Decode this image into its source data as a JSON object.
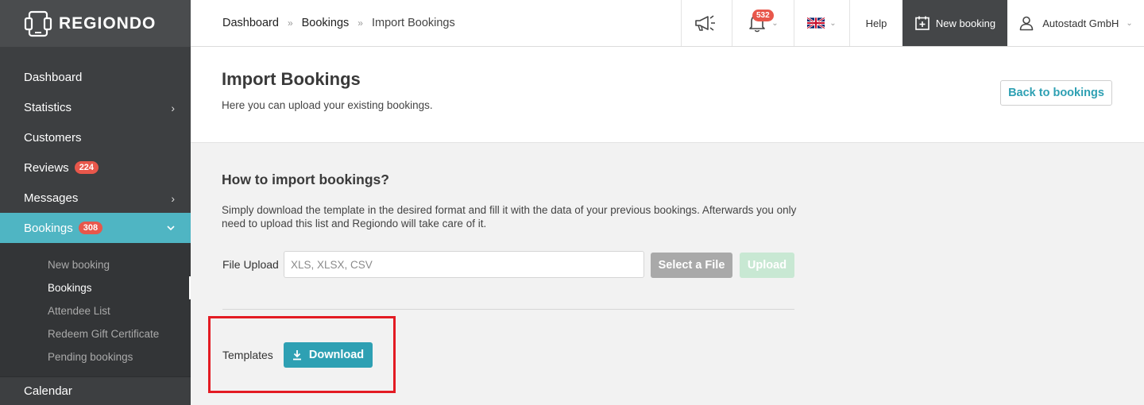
{
  "brand": {
    "name": "REGIONDO"
  },
  "sidebar": {
    "items": [
      {
        "label": "Dashboard"
      },
      {
        "label": "Statistics"
      },
      {
        "label": "Customers"
      },
      {
        "label": "Reviews",
        "badge": "224"
      },
      {
        "label": "Messages"
      },
      {
        "label": "Bookings",
        "badge": "308"
      }
    ],
    "bookings_sub": [
      {
        "label": "New booking"
      },
      {
        "label": "Bookings"
      },
      {
        "label": "Attendee List"
      },
      {
        "label": "Redeem Gift Certificate"
      },
      {
        "label": "Pending bookings"
      }
    ],
    "bottom_item": "Calendar"
  },
  "topbar": {
    "breadcrumb": [
      "Dashboard",
      "Bookings",
      "Import Bookings"
    ],
    "breadcrumb_sep": "»",
    "notifications_count": "532",
    "help_label": "Help",
    "new_booking_label": "New booking",
    "user_name": "Autostadt GmbH"
  },
  "header": {
    "title": "Import Bookings",
    "subtitle": "Here you can upload your existing bookings.",
    "back_button": "Back to bookings"
  },
  "import": {
    "section_title": "How to import bookings?",
    "description": "Simply download the template in the desired format and fill it with the data of your previous bookings. Afterwards you only need to upload this list and Regiondo will take care of it.",
    "file_upload_label": "File Upload",
    "file_upload_placeholder": "XLS, XLSX, CSV",
    "select_button": "Select a File",
    "upload_button": "Upload",
    "templates_label": "Templates",
    "download_button": "Download"
  },
  "colors": {
    "accent": "#4fb5c3",
    "button_primary": "#2ea0b3",
    "badge": "#e8574b",
    "highlight": "#e31b23"
  }
}
